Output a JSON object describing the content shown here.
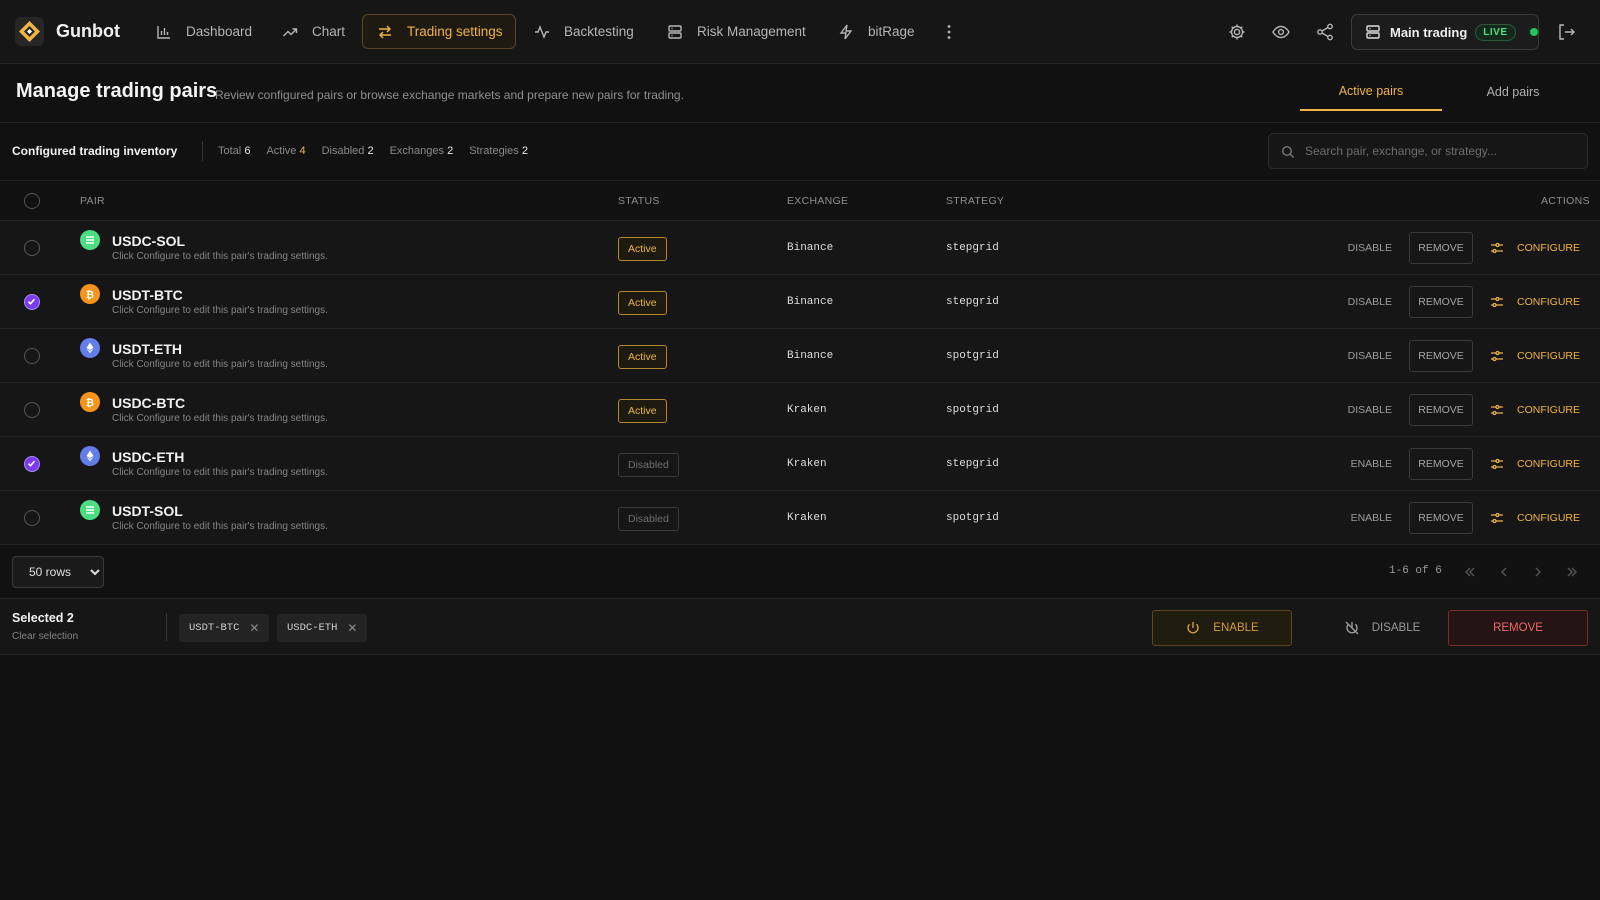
{
  "app": {
    "name": "Gunbot"
  },
  "nav": {
    "items": [
      {
        "label": "Dashboard",
        "icon": "bar-chart-icon"
      },
      {
        "label": "Chart",
        "icon": "trend-up-icon"
      },
      {
        "label": "Trading settings",
        "icon": "swap-arrows-icon",
        "active": true
      },
      {
        "label": "Backtesting",
        "icon": "activity-icon"
      },
      {
        "label": "Risk Management",
        "icon": "server-icon"
      },
      {
        "label": "bitRage",
        "icon": "lightning-icon"
      }
    ],
    "trading_mode": {
      "label": "Main trading",
      "badge": "LIVE"
    }
  },
  "header": {
    "title": "Manage trading pairs",
    "subtitle": "Review configured pairs or browse exchange markets and prepare new pairs for trading.",
    "tabs": [
      {
        "label": "Active pairs",
        "active": true
      },
      {
        "label": "Add pairs",
        "active": false
      }
    ]
  },
  "inventory": {
    "title": "Configured trading inventory",
    "stats": {
      "total_label": "Total",
      "total": "6",
      "active_label": "Active",
      "active": "4",
      "disabled_label": "Disabled",
      "disabled": "2",
      "exchanges_label": "Exchanges",
      "exchanges": "2",
      "strategies_label": "Strategies",
      "strategies": "2"
    },
    "search_placeholder": "Search pair, exchange, or strategy..."
  },
  "table": {
    "columns": {
      "pair": "PAIR",
      "status": "STATUS",
      "exchange": "EXCHANGE",
      "strategy": "STRATEGY",
      "actions": "ACTIONS"
    },
    "hint": "Click Configure to edit this pair's trading settings.",
    "remove_label": "REMOVE",
    "configure_label": "CONFIGURE",
    "rows": [
      {
        "pair": "USDC-SOL",
        "coin": "sol",
        "status": "Active",
        "exchange": "Binance",
        "strategy": "stepgrid",
        "toggle": "DISABLE",
        "selected": false,
        "hint": "Click Configure to edit this pair's trading settings.",
        "remove": "REMOVE",
        "configure": "CONFIGURE"
      },
      {
        "pair": "USDT-BTC",
        "coin": "btc",
        "status": "Active",
        "exchange": "Binance",
        "strategy": "stepgrid",
        "toggle": "DISABLE",
        "selected": true,
        "hint": "Click Configure to edit this pair's trading settings.",
        "remove": "REMOVE",
        "configure": "CONFIGURE"
      },
      {
        "pair": "USDT-ETH",
        "coin": "eth",
        "status": "Active",
        "exchange": "Binance",
        "strategy": "spotgrid",
        "toggle": "DISABLE",
        "selected": false,
        "hint": "Click Configure to edit this pair's trading settings.",
        "remove": "REMOVE",
        "configure": "CONFIGURE"
      },
      {
        "pair": "USDC-BTC",
        "coin": "btc",
        "status": "Active",
        "exchange": "Kraken",
        "strategy": "spotgrid",
        "toggle": "DISABLE",
        "selected": false,
        "hint": "Click Configure to edit this pair's trading settings.",
        "remove": "REMOVE",
        "configure": "CONFIGURE"
      },
      {
        "pair": "USDC-ETH",
        "coin": "eth",
        "status": "Disabled",
        "exchange": "Kraken",
        "strategy": "stepgrid",
        "toggle": "ENABLE",
        "selected": true,
        "hint": "Click Configure to edit this pair's trading settings.",
        "remove": "REMOVE",
        "configure": "CONFIGURE"
      },
      {
        "pair": "USDT-SOL",
        "coin": "sol",
        "status": "Disabled",
        "exchange": "Kraken",
        "strategy": "spotgrid",
        "toggle": "ENABLE",
        "selected": false,
        "hint": "Click Configure to edit this pair's trading settings.",
        "remove": "REMOVE",
        "configure": "CONFIGURE"
      }
    ]
  },
  "pagination": {
    "rows_per_page": "50 rows",
    "range": "1-6 of 6"
  },
  "selection": {
    "title": "Selected 2",
    "clear_label": "Clear selection",
    "chips": [
      "USDT-BTC",
      "USDC-ETH"
    ],
    "enable_label": "ENABLE",
    "disable_label": "DISABLE",
    "remove_label": "REMOVE"
  },
  "colors": {
    "accent": "#f0b443",
    "danger": "#ef6a6a",
    "live": "#22c55e",
    "selected": "#7c3aed",
    "sol": "#4ade80",
    "btc": "#f7931a",
    "eth": "#627eea"
  }
}
